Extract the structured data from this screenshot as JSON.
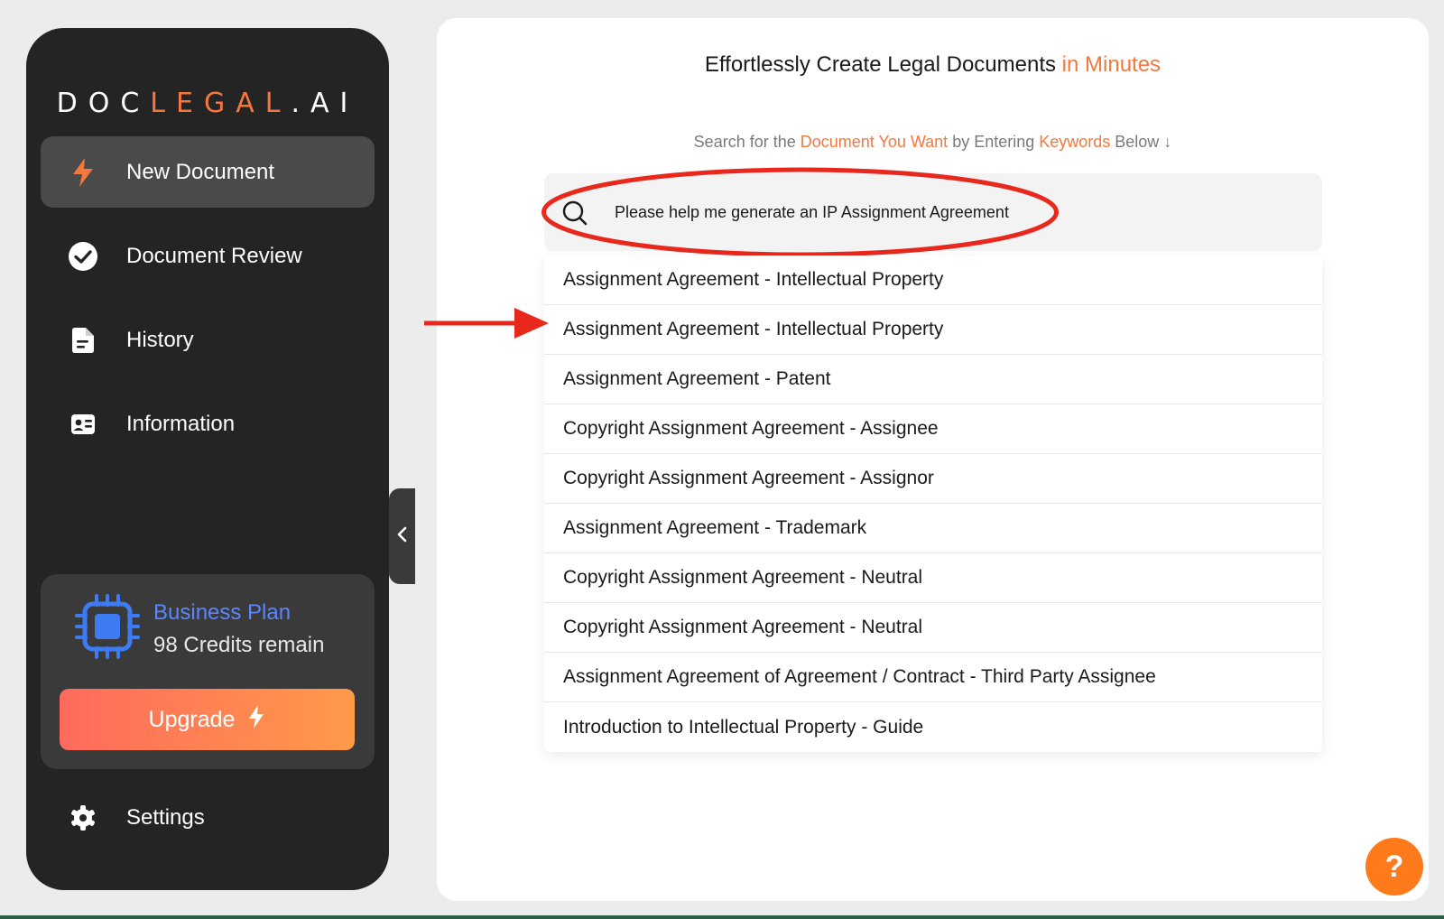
{
  "sidebar": {
    "logo": {
      "part1": "DOC",
      "part2": "LEGAL",
      "part3": ".AI"
    },
    "nav": [
      {
        "label": "New Document",
        "icon": "bolt-icon",
        "active": true
      },
      {
        "label": "Document Review",
        "icon": "check-circle-icon",
        "active": false
      },
      {
        "label": "History",
        "icon": "document-icon",
        "active": false
      },
      {
        "label": "Information",
        "icon": "id-card-icon",
        "active": false
      }
    ],
    "plan": {
      "name": "Business Plan",
      "credits": "98 Credits remain",
      "upgrade_label": "Upgrade"
    },
    "settings_label": "Settings"
  },
  "main": {
    "headline": {
      "text": "Effortlessly Create Legal Documents ",
      "accent": "in Minutes"
    },
    "subline": {
      "t1": "Search for the ",
      "a1": "Document You Want",
      "t2": " by Entering ",
      "a2": "Keywords",
      "t3": " Below ↓"
    },
    "search": {
      "value": "Please help me generate an IP Assignment Agreement"
    },
    "results": [
      "Assignment Agreement - Intellectual Property",
      "Assignment Agreement - Intellectual Property",
      "Assignment Agreement - Patent",
      "Copyright Assignment Agreement - Assignee",
      "Copyright Assignment Agreement - Assignor",
      "Assignment Agreement - Trademark",
      "Copyright Assignment Agreement - Neutral",
      "Copyright Assignment Agreement - Neutral",
      "Assignment Agreement of Agreement / Contract - Third Party Assignee",
      "Introduction to Intellectual Property - Guide"
    ]
  },
  "help_label": "?",
  "colors": {
    "accent": "#f4783e",
    "plan_blue": "#5a86ff",
    "annotation_red": "#e8281c"
  }
}
